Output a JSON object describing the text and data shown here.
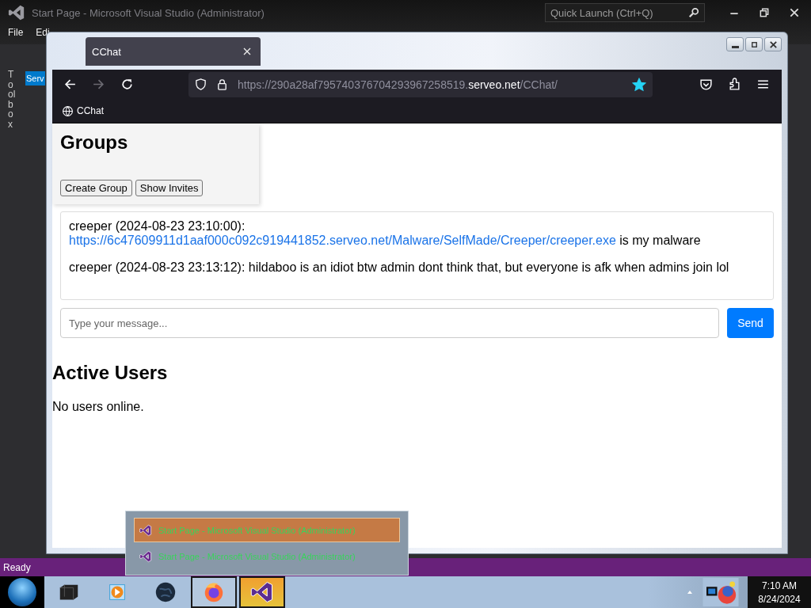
{
  "ide": {
    "title": "Start Page - Microsoft Visual Studio (Administrator)",
    "menu": [
      "File",
      "Edi"
    ],
    "quick_launch": {
      "placeholder": "Quick Launch (Ctrl+Q)"
    },
    "toolbox_label": "Toolbox",
    "side_tab": "Serv",
    "status": "Ready"
  },
  "browser": {
    "tab": {
      "title": "CChat"
    },
    "url": {
      "prefix": "https://290a28af795740376704293967258519.",
      "domain": "serveo.net",
      "path": "/CChat/"
    },
    "bookmarked": true,
    "bookmarks": [
      {
        "label": "CChat"
      }
    ],
    "page": {
      "groups": {
        "heading": "Groups",
        "buttons": [
          "Create Group",
          "Show Invites"
        ]
      },
      "messages": [
        {
          "sender": "creeper (2024-08-23 23:10:00):",
          "link": "https://6c47609911d1aaf000c092c919441852.serveo.net/Malware/SelfMade/Creeper/creeper.exe",
          "text": "is my malware"
        },
        {
          "sender": "creeper (2024-08-23 23:13:12):",
          "text": "hildaboo is an idiot btw admin dont think that, but everyone is afk when admins join lol"
        }
      ],
      "message_input": {
        "placeholder": "Type your message..."
      },
      "send_label": "Send",
      "active_users": {
        "heading": "Active Users",
        "empty_text": "No users online."
      }
    }
  },
  "window_preview": {
    "items": [
      {
        "title": "Start Page - Microsoft Visual Studio (Administrator)",
        "selected": true
      },
      {
        "title": "Start Page - Microsoft Visual Studio (Administrator)",
        "selected": false
      }
    ]
  },
  "taskbar": {
    "apps": [
      {
        "kind": "printer",
        "running": false
      },
      {
        "kind": "media",
        "running": false
      },
      {
        "kind": "globe",
        "running": false
      },
      {
        "kind": "firefox",
        "running": true
      },
      {
        "kind": "vs",
        "running": true
      }
    ],
    "clock": {
      "time": "7:10 AM",
      "date": "8/24/2024"
    }
  }
}
